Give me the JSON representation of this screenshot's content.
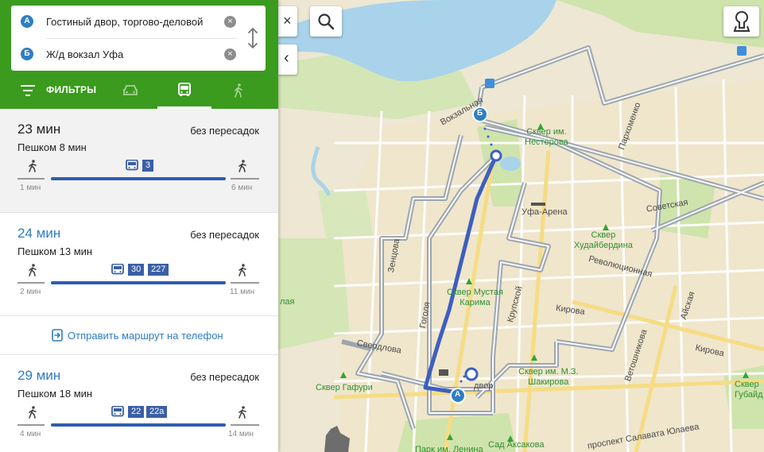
{
  "route": {
    "from": {
      "badge": "А",
      "text": "Гостиный двор, торгово-деловой",
      "clear": "×"
    },
    "to": {
      "badge": "Б",
      "text": "Ж/д вокзал Уфа",
      "clear": "×"
    }
  },
  "tabs": {
    "filters_label": "ФИЛЬТРЫ",
    "items": [
      {
        "name": "car",
        "icon": "car-icon",
        "active": false
      },
      {
        "name": "bus",
        "icon": "bus-icon",
        "active": true
      },
      {
        "name": "walk",
        "icon": "walk-icon",
        "active": false
      }
    ]
  },
  "options": [
    {
      "duration": "23 мин",
      "transfers": "без пересадок",
      "walk": "Пешком 8 мин",
      "walk_before": "1 мин",
      "walk_after": "6 мин",
      "routes": [
        "3"
      ],
      "selected": true
    },
    {
      "duration": "24 мин",
      "transfers": "без пересадок",
      "walk": "Пешком 13 мин",
      "walk_before": "2 мин",
      "walk_after": "11 мин",
      "routes": [
        "30",
        "227"
      ],
      "selected": false
    },
    {
      "duration": "29 мин",
      "transfers": "без пересадок",
      "walk": "Пешком 18 мин",
      "walk_before": "4 мин",
      "walk_after": "14 мин",
      "routes": [
        "22",
        "22а"
      ],
      "selected": false
    }
  ],
  "send_to_phone": "Отправить маршрут на телефон",
  "map_controls": {
    "close": "×",
    "collapse": "‹"
  },
  "map_labels": {
    "vokzalnaya": "Вокзальная",
    "skver_nest": "Сквер им.\nНестерова",
    "parkhomenko": "Пархоменко",
    "ufa_arena": "Уфа-Арена",
    "sovetskaya": "Советская",
    "skver_khud": "Сквер\nХудайбердина",
    "revolyuts": "Революционная",
    "zentsova": "Зенцова",
    "skver_must": "Сквер Мустая\nКарима",
    "krupskoy": "Крупской",
    "kirova": "Кирова",
    "kirova2": "Кирова",
    "aiskaya": "Айская",
    "gogolya": "Гоголя",
    "sverdlova": "Свердлова",
    "vetoshnikova": "Ветошникова",
    "skver_shak": "Сквер им. М.З.\nШакирова",
    "skver_gaf": "Сквер Гафури",
    "dvor": "двор",
    "skver_gub": "Сквер\nГубайд",
    "salavata": "проспект Салавата Юлаева",
    "sad_aksakova": "Сад Аксакова",
    "park_lenina": "Парк им. Ленина",
    "lay": "лая",
    "marker_a": "А",
    "marker_b": "Б"
  },
  "colors": {
    "header_green": "#3a9b1e",
    "route_blue": "#3e5fbf",
    "accent_blue": "#2f7cc4",
    "river": "#a9d3ea",
    "park": "#c6dea3"
  }
}
